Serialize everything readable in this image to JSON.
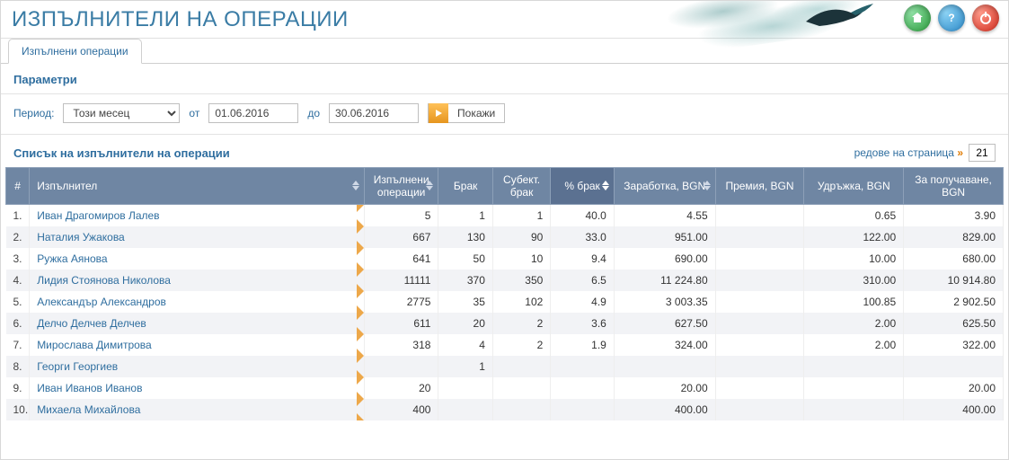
{
  "header": {
    "title": "ИЗПЪЛНИТЕЛИ НА ОПЕРАЦИИ"
  },
  "tabs": [
    {
      "label": "Изпълнени операции"
    }
  ],
  "sections": {
    "params_title": "Параметри",
    "list_title": "Списък на изпълнители на операции"
  },
  "params": {
    "period_label": "Период:",
    "period_value": "Този месец",
    "from_label": "от",
    "from_value": "01.06.2016",
    "to_label": "до",
    "to_value": "30.06.2016",
    "show_label": "Покажи"
  },
  "rpp": {
    "link_text": "редове на страница",
    "value": "21"
  },
  "columns": {
    "num": "#",
    "performer": "Изпълнител",
    "ops": "Изпълнени операции",
    "brak": "Брак",
    "sbrak": "Субект. брак",
    "pbrak": "% брак",
    "earn": "Заработка, BGN",
    "prem": "Премия, BGN",
    "ded": "Удръжка, BGN",
    "rec": "За получаване, BGN"
  },
  "rows": [
    {
      "idx": "1.",
      "name": "Иван Драгомиров Лалев",
      "ops": "5",
      "brak": "1",
      "sbrak": "1",
      "pbrak": "40.0",
      "earn": "4.55",
      "prem": "",
      "ded": "0.65",
      "rec": "3.90"
    },
    {
      "idx": "2.",
      "name": "Наталия Ужакова",
      "ops": "667",
      "brak": "130",
      "sbrak": "90",
      "pbrak": "33.0",
      "earn": "951.00",
      "prem": "",
      "ded": "122.00",
      "rec": "829.00"
    },
    {
      "idx": "3.",
      "name": "Ружка Аянова",
      "ops": "641",
      "brak": "50",
      "sbrak": "10",
      "pbrak": "9.4",
      "earn": "690.00",
      "prem": "",
      "ded": "10.00",
      "rec": "680.00"
    },
    {
      "idx": "4.",
      "name": "Лидия Стоянова Николова",
      "ops": "11111",
      "brak": "370",
      "sbrak": "350",
      "pbrak": "6.5",
      "earn": "11 224.80",
      "prem": "",
      "ded": "310.00",
      "rec": "10 914.80"
    },
    {
      "idx": "5.",
      "name": "Александър Александров",
      "ops": "2775",
      "brak": "35",
      "sbrak": "102",
      "pbrak": "4.9",
      "earn": "3 003.35",
      "prem": "",
      "ded": "100.85",
      "rec": "2 902.50"
    },
    {
      "idx": "6.",
      "name": "Делчо Делчев Делчев",
      "ops": "611",
      "brak": "20",
      "sbrak": "2",
      "pbrak": "3.6",
      "earn": "627.50",
      "prem": "",
      "ded": "2.00",
      "rec": "625.50"
    },
    {
      "idx": "7.",
      "name": "Мирослава Димитрова",
      "ops": "318",
      "brak": "4",
      "sbrak": "2",
      "pbrak": "1.9",
      "earn": "324.00",
      "prem": "",
      "ded": "2.00",
      "rec": "322.00"
    },
    {
      "idx": "8.",
      "name": "Георги Георгиев",
      "ops": "",
      "brak": "1",
      "sbrak": "",
      "pbrak": "",
      "earn": "",
      "prem": "",
      "ded": "",
      "rec": ""
    },
    {
      "idx": "9.",
      "name": "Иван Иванов Иванов",
      "ops": "20",
      "brak": "",
      "sbrak": "",
      "pbrak": "",
      "earn": "20.00",
      "prem": "",
      "ded": "",
      "rec": "20.00"
    },
    {
      "idx": "10.",
      "name": "Михаела Михайлова",
      "ops": "400",
      "brak": "",
      "sbrak": "",
      "pbrak": "",
      "earn": "400.00",
      "prem": "",
      "ded": "",
      "rec": "400.00"
    }
  ]
}
